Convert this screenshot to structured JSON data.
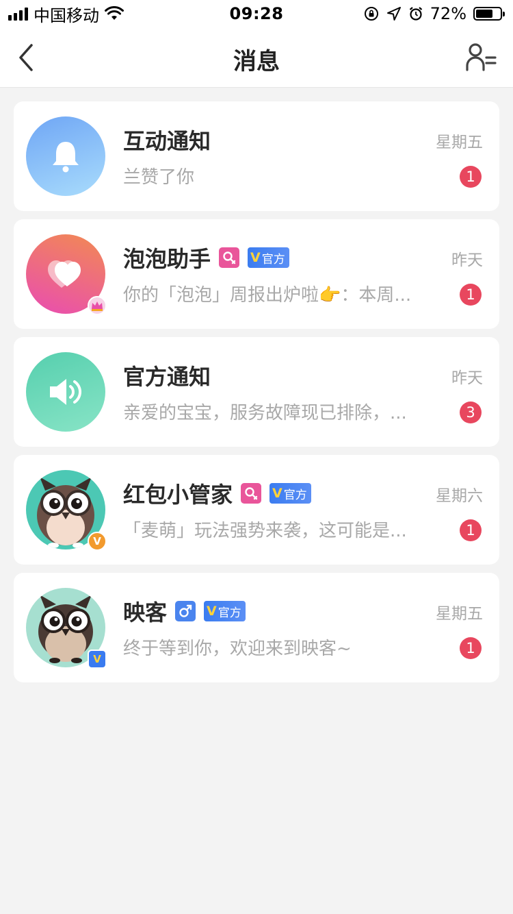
{
  "status_bar": {
    "carrier": "中国移动",
    "time": "09:28",
    "battery_pct": "72%",
    "battery_level": 0.72
  },
  "nav": {
    "title": "消息",
    "back_icon": "chevron-left-icon",
    "contacts_icon": "user-list-icon"
  },
  "conversations": [
    {
      "name": "互动通知",
      "preview": "兰赞了你",
      "date": "星期五",
      "unread": "1",
      "avatar_icon": "bell-icon",
      "avatar_colors": [
        "#7bb6f7",
        "#a8d8fb"
      ]
    },
    {
      "name": "泡泡助手",
      "preview": "你的「泡泡」周报出炉啦👉：本周...",
      "date": "昨天",
      "unread": "1",
      "gender": "female",
      "official": "官方",
      "avatar_icon": "heart-icon",
      "avatar_colors": [
        "#f07a5a",
        "#e84fa8"
      ]
    },
    {
      "name": "官方通知",
      "preview": "亲爱的宝宝，服务故障现已排除，...",
      "date": "昨天",
      "unread": "3",
      "avatar_icon": "speaker-icon",
      "avatar_colors": [
        "#5cd6b0",
        "#8ae0c8"
      ]
    },
    {
      "name": "红包小管家",
      "preview": "「麦萌」玩法强势来袭，这可能是...",
      "date": "星期六",
      "unread": "1",
      "gender": "female",
      "official": "官方",
      "avatar_icon": "owl-icon",
      "avatar_colors": [
        "#4cc8b4",
        "#4cc8b4"
      ]
    },
    {
      "name": "映客",
      "preview": "终于等到你，欢迎来到映客~",
      "date": "星期五",
      "unread": "1",
      "gender": "male",
      "official": "官方",
      "avatar_icon": "owl-icon",
      "avatar_colors": [
        "#a8e0d2",
        "#a8e0d2"
      ]
    }
  ]
}
